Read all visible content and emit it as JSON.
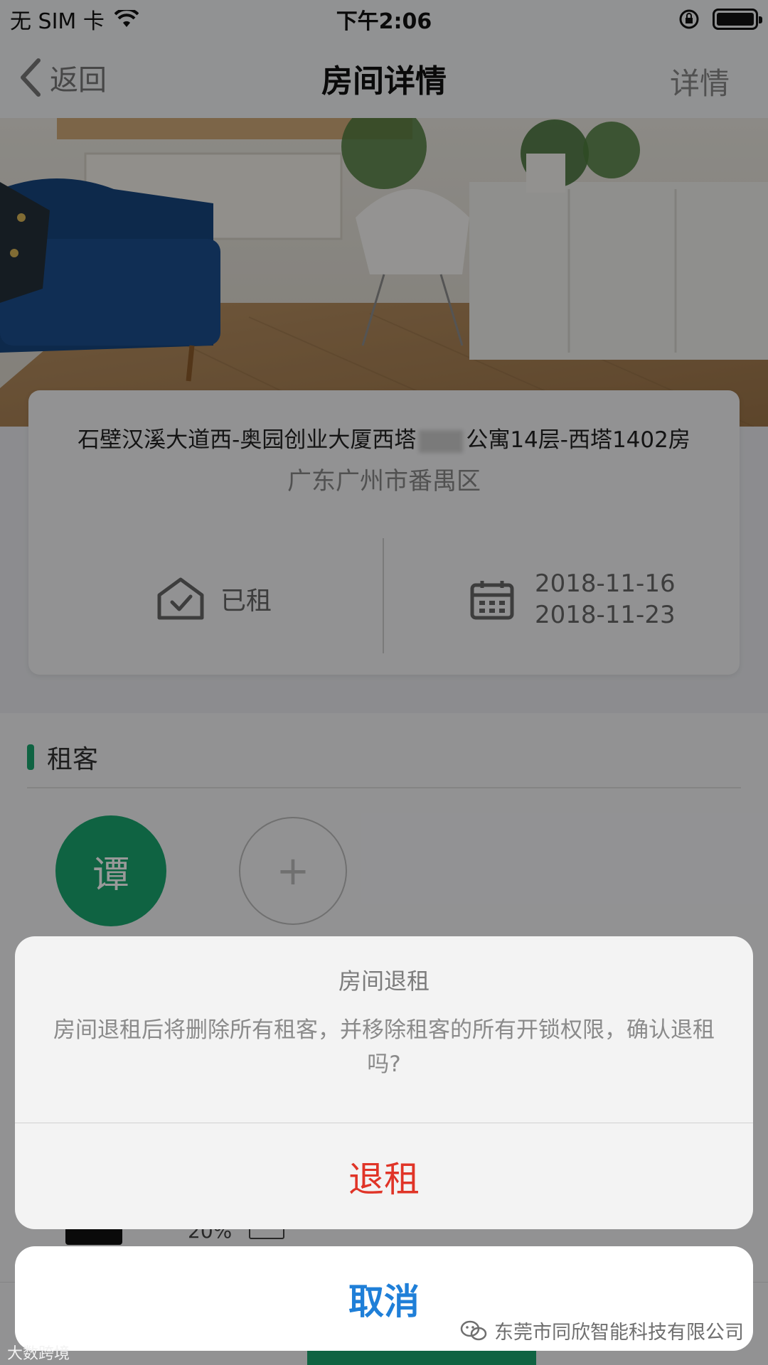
{
  "status_bar": {
    "carrier": "无 SIM 卡",
    "time": "下午2:06"
  },
  "nav": {
    "back_label": "返回",
    "title": "房间详情",
    "detail_label": "详情"
  },
  "room": {
    "address_prefix": "石壁汉溪大道西-奥园创业大厦西塔",
    "address_suffix": "公寓14层-西塔1402房",
    "region": "广东广州市番禺区",
    "status": "已租",
    "date_start": "2018-11-16",
    "date_end": "2018-11-23"
  },
  "tenants": {
    "section_title": "租客",
    "avatar_char": "谭",
    "add_symbol": "+"
  },
  "device": {
    "battery_pct": "20%"
  },
  "action_sheet": {
    "title": "房间退租",
    "message": "房间退租后将删除所有租客，并移除租客的所有开锁权限，确认退租吗?",
    "confirm_label": "退租",
    "cancel_label": "取消"
  },
  "watermark": {
    "right": "东莞市同欣智能科技有限公司",
    "left": "大数跨境"
  },
  "colors": {
    "accent_green": "#1aa56e",
    "destructive_red": "#e03427",
    "ios_blue": "#1f7fd8"
  }
}
